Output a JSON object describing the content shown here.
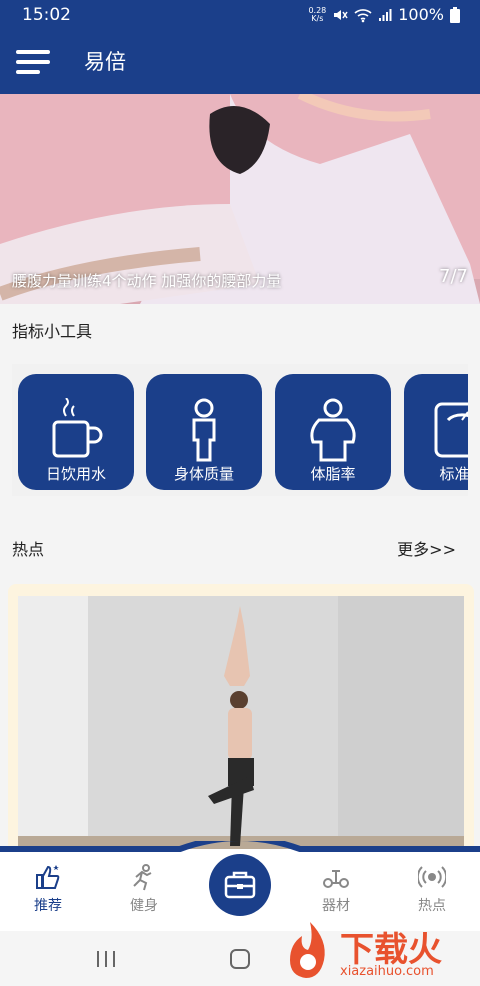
{
  "status": {
    "time": "15:02",
    "speed_value": "0.28",
    "speed_unit": "K/s",
    "battery": "100%"
  },
  "appbar": {
    "title": "易倍"
  },
  "banner": {
    "caption": "腰腹力量训练4个动作 加强你的腰部力量",
    "pager": "7/7"
  },
  "tools": {
    "section_title": "指标小工具",
    "items": [
      {
        "label": "日饮用水",
        "icon": "cup-icon"
      },
      {
        "label": "身体质量",
        "icon": "person-icon"
      },
      {
        "label": "体脂率",
        "icon": "fat-person-icon"
      },
      {
        "label": "标准体",
        "icon": "scale-icon"
      }
    ]
  },
  "hot": {
    "section_title": "热点",
    "more": "更多>>"
  },
  "tabbar": {
    "tabs": [
      {
        "label": "推荐",
        "icon": "thumbs-up-icon",
        "active": true
      },
      {
        "label": "健身",
        "icon": "runner-icon",
        "active": false
      },
      {
        "label": "器材",
        "icon": "equipment-icon",
        "active": false
      },
      {
        "label": "热点",
        "icon": "broadcast-icon",
        "active": false
      }
    ],
    "center_icon": "toolbox-icon"
  },
  "watermark": {
    "text": "下载火",
    "url": "xiazaihuo.com"
  },
  "colors": {
    "primary": "#1b3f8a",
    "banner_bg": "#e8b4bd",
    "card_bg": "#fdf4df",
    "inactive": "#888888"
  }
}
